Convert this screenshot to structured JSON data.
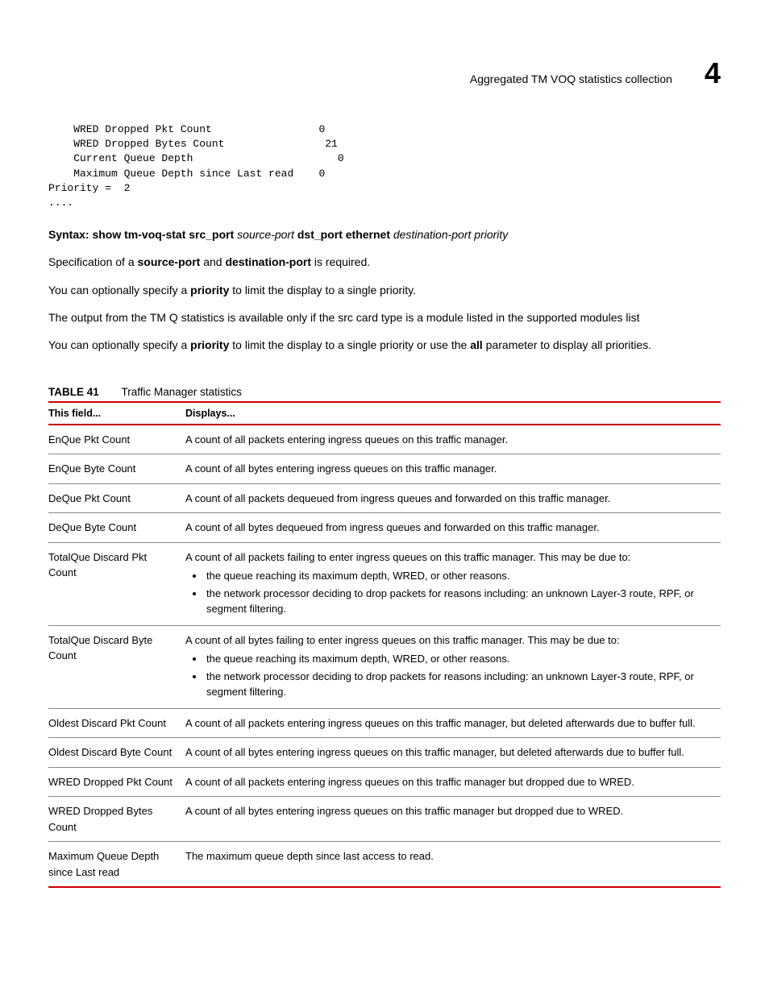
{
  "header": {
    "title": "Aggregated TM VOQ statistics collection",
    "chapter": "4"
  },
  "code": {
    "line1": "    WRED Dropped Pkt Count                 0",
    "line2": "    WRED Dropped Bytes Count                21",
    "line3": "    Current Queue Depth                       0",
    "line4": "    Maximum Queue Depth since Last read    0",
    "line5": "Priority =  2",
    "line6": "...."
  },
  "syntax": {
    "label": "Syntax: ",
    "cmd": "show tm-voq-stat src_port ",
    "arg1": "source-port ",
    "kw2": "dst_port ethernet ",
    "arg2": "destination-port priority"
  },
  "para1": {
    "t1": "Specification of a ",
    "b1": "source-port",
    "t2": " and ",
    "b2": "destination-port",
    "t3": " is required."
  },
  "para2": {
    "t1": "You can optionally specify a ",
    "b1": "priority",
    "t2": " to limit the display to a single priority."
  },
  "para3": "The output from the TM Q statistics is available only if the src card type is a module listed in the supported modules list",
  "para4": {
    "t1": "You can optionally specify a ",
    "b1": "priority",
    "t2": " to limit the display to a single priority or use the ",
    "b2": "all",
    "t3": " parameter to display all priorities."
  },
  "table": {
    "label": "TABLE 41",
    "title": "Traffic Manager statistics",
    "head": {
      "col1": "This field...",
      "col2": "Displays..."
    },
    "rows": [
      {
        "field": "EnQue Pkt Count",
        "desc": "A count of all packets entering ingress queues on this traffic manager."
      },
      {
        "field": "EnQue Byte Count",
        "desc": "A count of all bytes entering ingress queues on this traffic manager."
      },
      {
        "field": "DeQue Pkt Count",
        "desc": "A count of all packets dequeued from ingress queues and forwarded on this traffic manager."
      },
      {
        "field": "DeQue Byte Count",
        "desc": "A count of all bytes dequeued from ingress queues and forwarded on this traffic manager."
      },
      {
        "field": "TotalQue Discard Pkt Count",
        "desc": "A count of all packets failing to enter ingress queues on this traffic manager. This may be due to:",
        "bullets": [
          "the queue reaching its maximum depth, WRED, or other reasons.",
          "the network processor deciding to drop packets for reasons including: an unknown Layer-3 route, RPF, or segment filtering."
        ]
      },
      {
        "field": "TotalQue Discard Byte Count",
        "desc": "A count of all bytes failing to enter ingress queues on this traffic manager. This may be due to:",
        "bullets": [
          "the queue reaching its maximum depth, WRED, or other reasons.",
          "the network processor deciding to drop packets for reasons including: an unknown Layer-3 route, RPF, or segment filtering."
        ]
      },
      {
        "field": "Oldest Discard Pkt Count",
        "desc": "A count of all packets entering ingress queues on this traffic manager, but deleted afterwards due to buffer full."
      },
      {
        "field": "Oldest Discard Byte Count",
        "desc": "A count of all bytes entering ingress queues on this traffic manager, but deleted afterwards due to buffer full."
      },
      {
        "field": "WRED Dropped Pkt Count",
        "desc": "A count of all packets entering ingress queues on this traffic manager but dropped due to WRED."
      },
      {
        "field": "WRED Dropped Bytes Count",
        "desc": "A count of all bytes entering ingress queues on this traffic manager but dropped due to WRED."
      },
      {
        "field": "Maximum Queue Depth since Last read",
        "desc": "The maximum queue depth since last access to read."
      }
    ]
  }
}
